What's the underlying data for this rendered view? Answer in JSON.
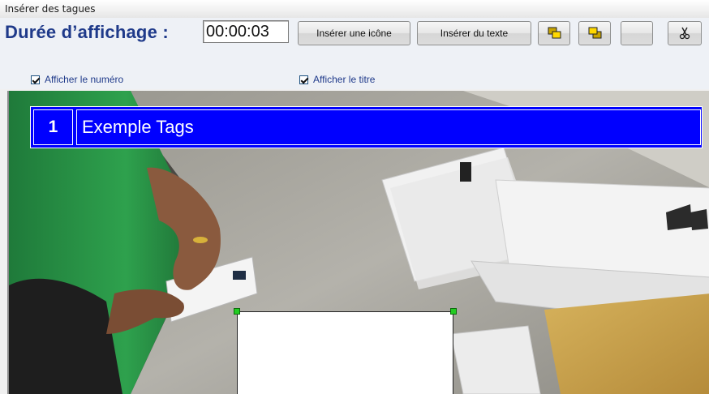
{
  "window": {
    "title": "Insérer des tagues"
  },
  "toolbar": {
    "duration_label": "Durée d’affichage :",
    "duration_value": "00:00:03",
    "insert_icon_label": "Insérer une icône",
    "insert_text_label": "Insérer du texte",
    "icon_buttons": [
      "bring-to-front-icon",
      "send-to-back-icon",
      "blank-button",
      "scissors-icon"
    ]
  },
  "options": {
    "show_number": {
      "label": "Afficher le numéro",
      "checked": true
    },
    "show_title": {
      "label": "Afficher le titre",
      "checked": true
    }
  },
  "preview": {
    "tag_number": "1",
    "tag_title": "Exemple Tags",
    "banner_color": "#0000ff",
    "handle_color": "#22cc22"
  }
}
